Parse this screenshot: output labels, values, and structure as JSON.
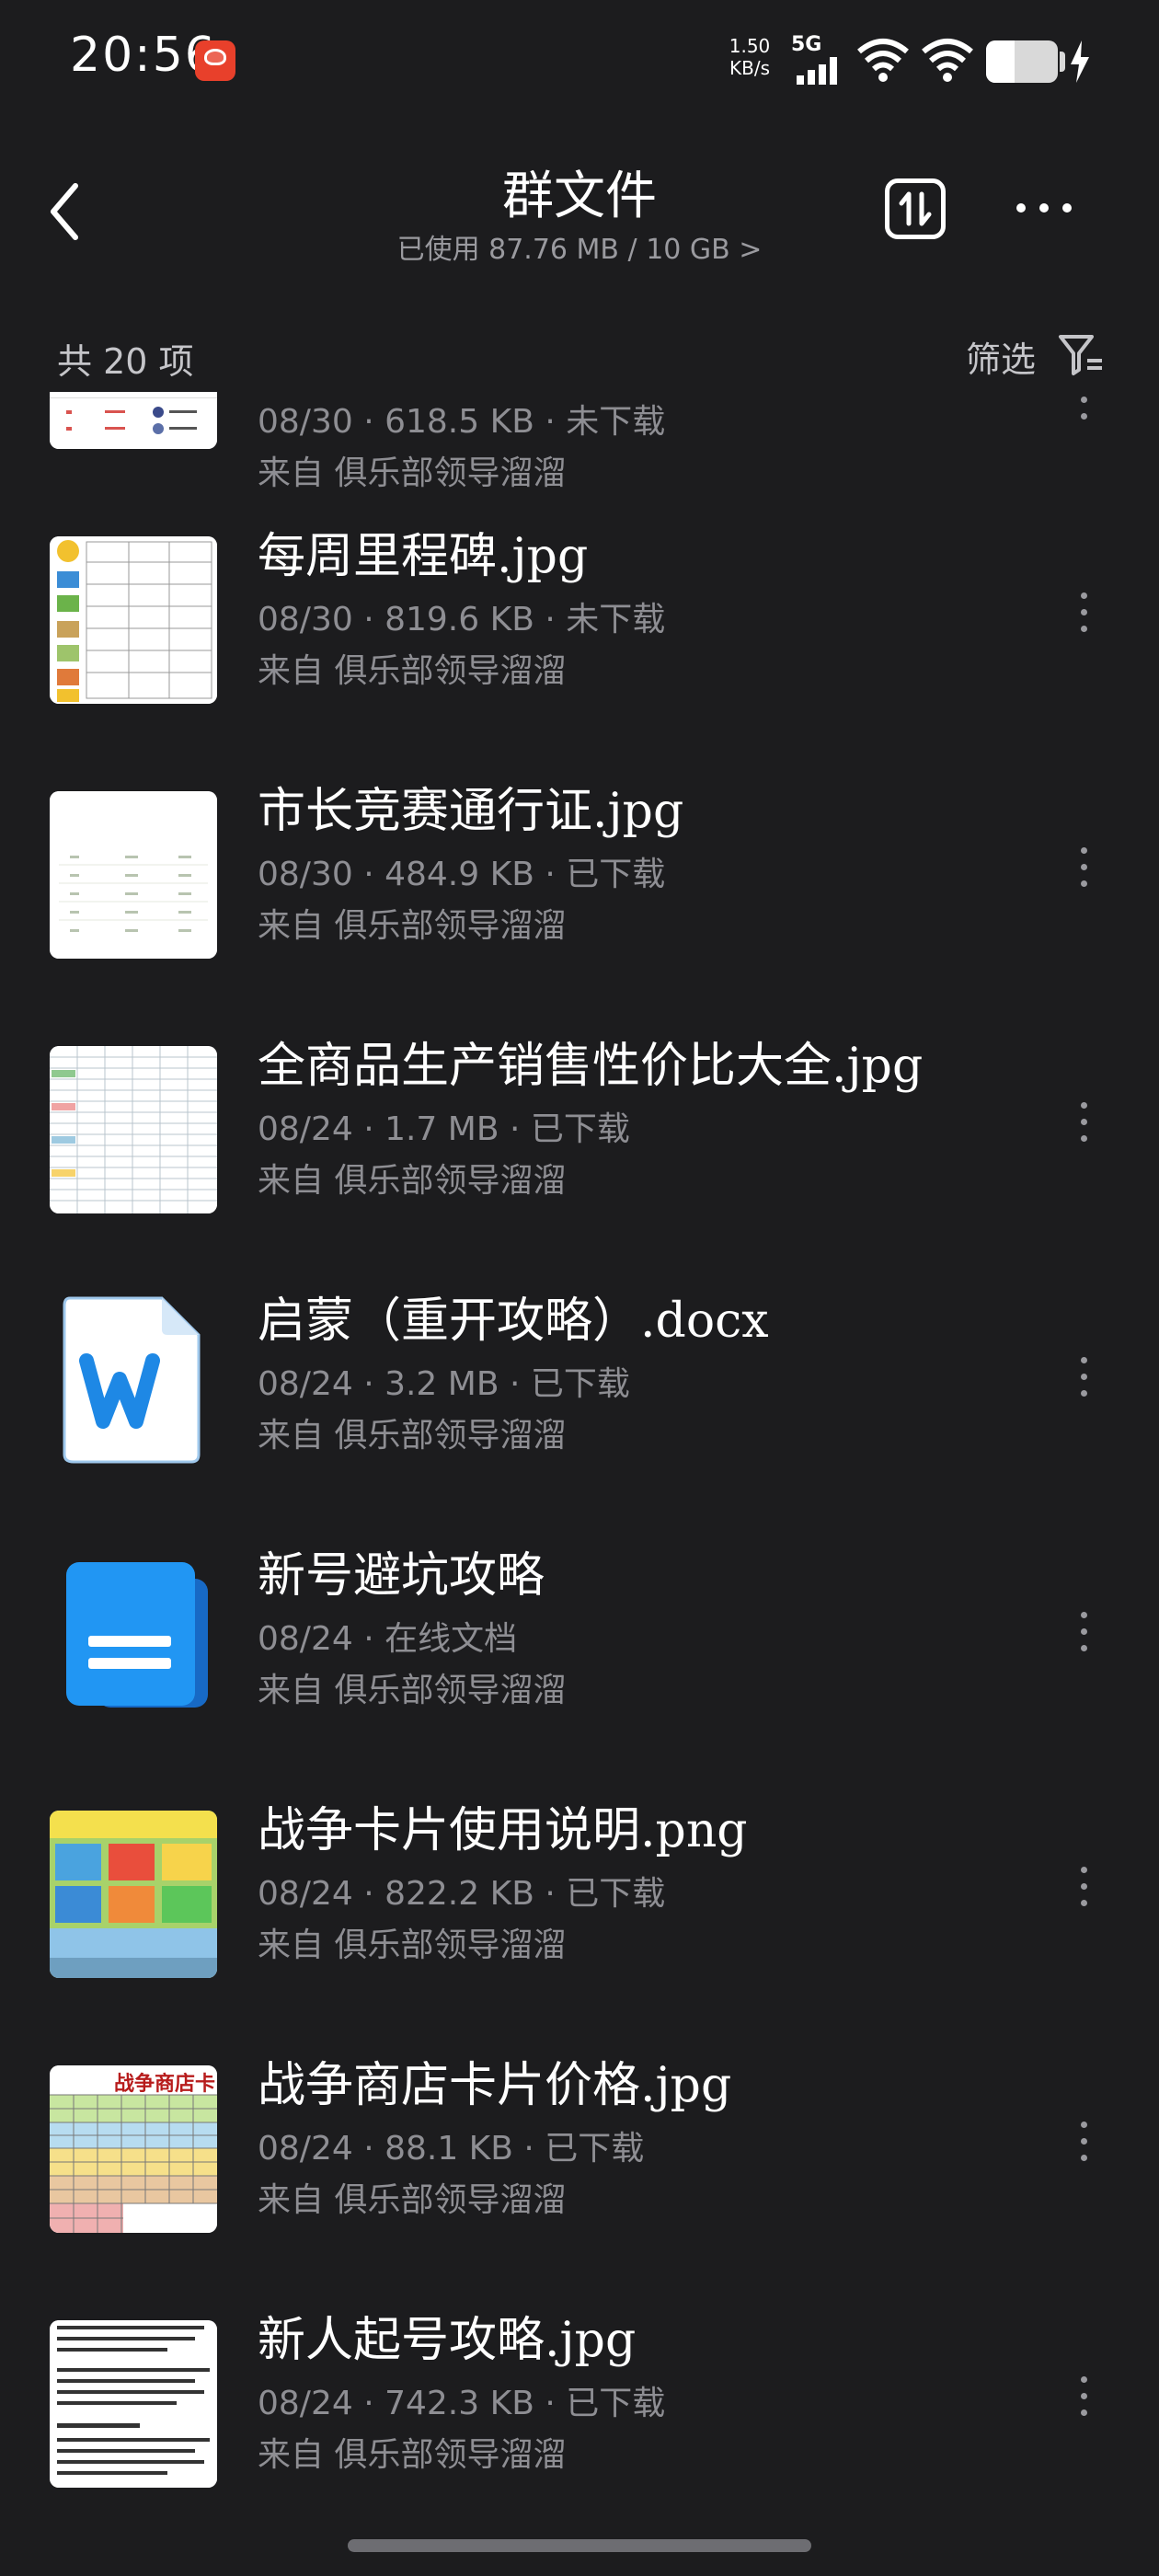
{
  "status_bar": {
    "time": "20:56",
    "net_speed_value": "1.50",
    "net_speed_unit": "KB/s",
    "network": "5G",
    "battery_level_percent": 40
  },
  "header": {
    "title": "群文件",
    "storage": "已使用 87.76 MB / 10 GB >"
  },
  "summary": {
    "count": "共 20 项",
    "filter_label": "筛选"
  },
  "files": [
    {
      "name": "",
      "meta": "08/30 · 618.5 KB · 未下载",
      "source": "来自 俱乐部领导溜溜",
      "thumb": "table-image",
      "icon": "image-thumbnail"
    },
    {
      "name": "每周里程碑.jpg",
      "meta": "08/30 · 819.6 KB · 未下载",
      "source": "来自 俱乐部领导溜溜",
      "thumb": "milestone-image",
      "icon": "image-thumbnail"
    },
    {
      "name": "市长竞赛通行证.jpg",
      "meta": "08/30 · 484.9 KB · 已下载",
      "source": "来自 俱乐部领导溜溜",
      "thumb": "white-table-image",
      "icon": "image-thumbnail"
    },
    {
      "name": "全商品生产销售性价比大全.jpg",
      "meta": "08/24 · 1.7 MB · 已下载",
      "source": "来自 俱乐部领导溜溜",
      "thumb": "spreadsheet-image",
      "icon": "image-thumbnail"
    },
    {
      "name": "启蒙（重开攻略）.docx",
      "meta": "08/24 · 3.2 MB · 已下载",
      "source": "来自 俱乐部领导溜溜",
      "thumb": "word",
      "icon": "word-document-icon"
    },
    {
      "name": "新号避坑攻略",
      "meta": "08/24 · 在线文档",
      "source": "来自 俱乐部领导溜溜",
      "thumb": "online-doc",
      "icon": "online-document-icon"
    },
    {
      "name": "战争卡片使用说明.png",
      "meta": "08/24 · 822.2 KB · 已下载",
      "source": "来自 俱乐部领导溜溜",
      "thumb": "card-guide-image",
      "icon": "image-thumbnail"
    },
    {
      "name": "战争商店卡片价格.jpg",
      "meta": "08/24 · 88.1 KB · 已下载",
      "source": "来自 俱乐部领导溜溜",
      "thumb": "price-table-image",
      "icon": "image-thumbnail",
      "thumb_text": "战争商店卡"
    },
    {
      "name": "新人起号攻略.jpg",
      "meta": "08/24 · 742.3 KB · 已下载",
      "source": "来自 俱乐部领导溜溜",
      "thumb": "text-doc-image",
      "icon": "image-thumbnail"
    }
  ],
  "colors": {
    "background": "#1c1c1e",
    "secondary_text": "#8e8e93",
    "word_blue": "#1e88e5",
    "online_doc_blue": "#2196f3"
  }
}
